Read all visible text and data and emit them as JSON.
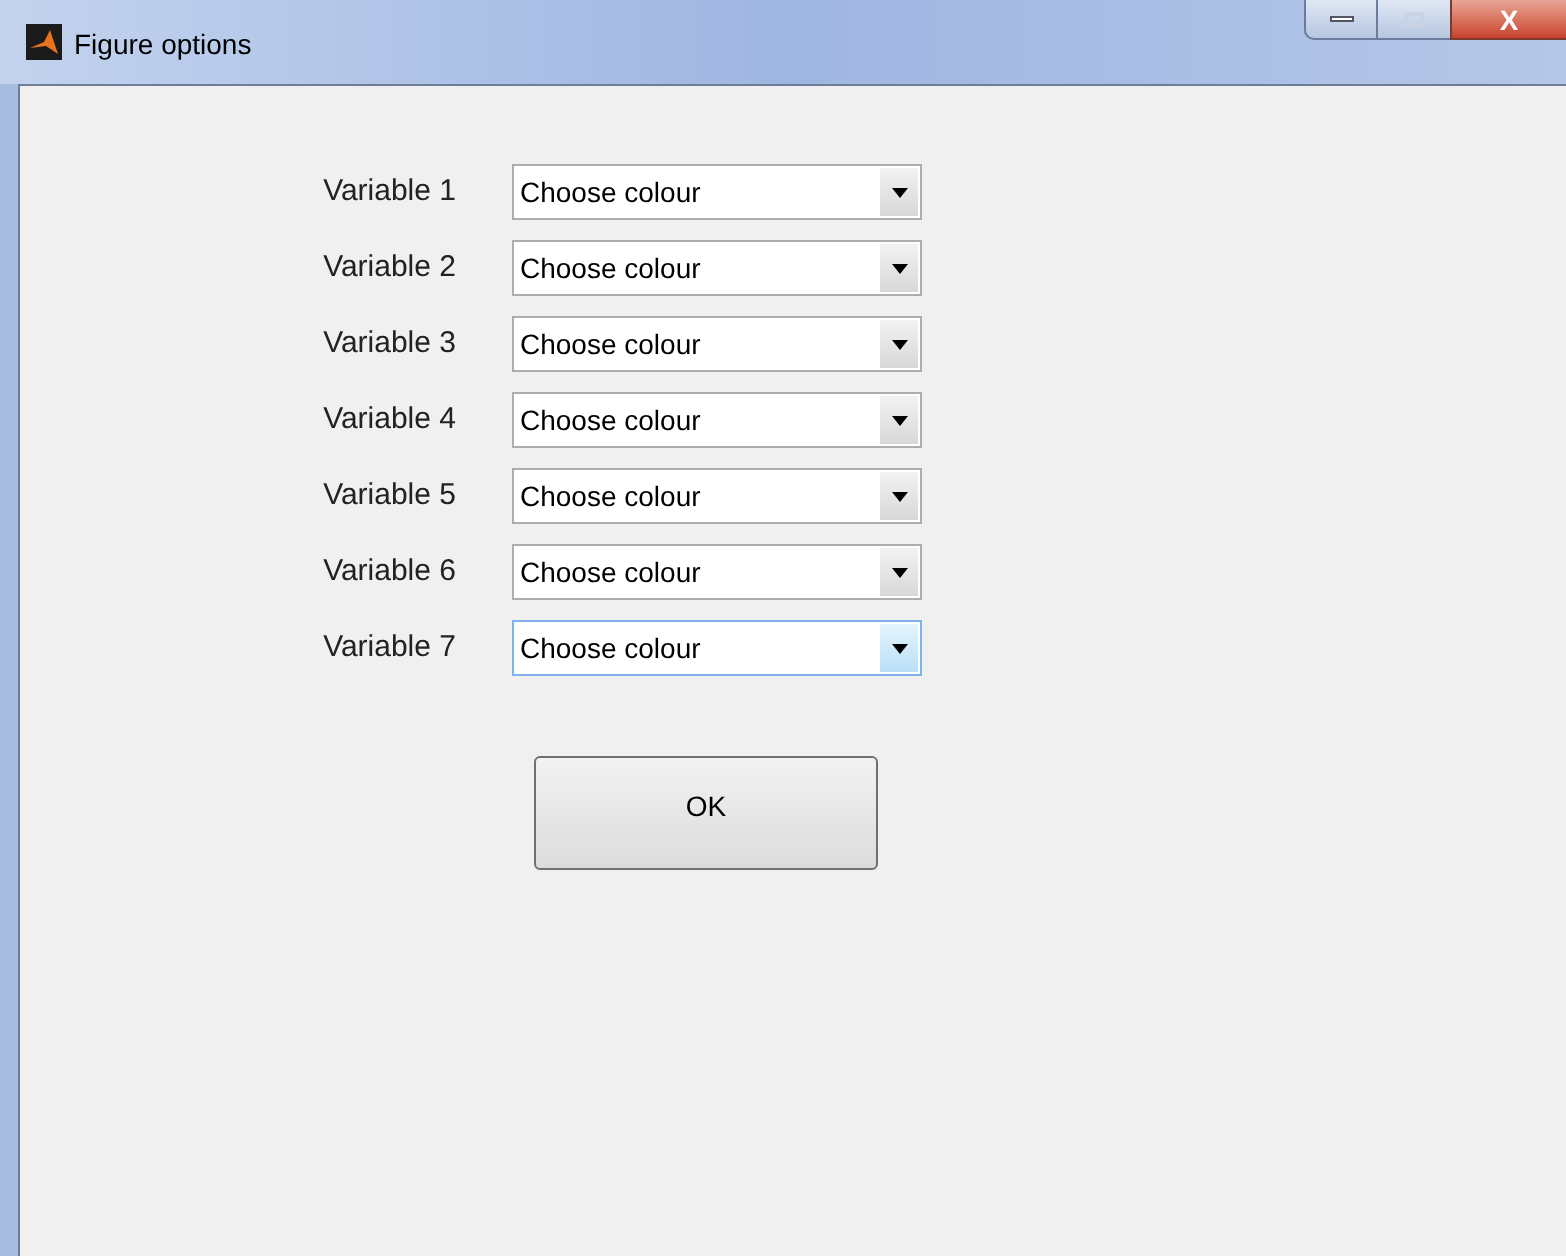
{
  "window": {
    "title": "Figure options",
    "close_label": "X"
  },
  "rows": [
    {
      "label": "Variable 1",
      "value": "Choose colour",
      "hovered": false
    },
    {
      "label": "Variable 2",
      "value": "Choose colour",
      "hovered": false
    },
    {
      "label": "Variable 3",
      "value": "Choose colour",
      "hovered": false
    },
    {
      "label": "Variable 4",
      "value": "Choose colour",
      "hovered": false
    },
    {
      "label": "Variable 5",
      "value": "Choose colour",
      "hovered": false
    },
    {
      "label": "Variable 6",
      "value": "Choose colour",
      "hovered": false
    },
    {
      "label": "Variable 7",
      "value": "Choose colour",
      "hovered": true
    }
  ],
  "ok_button": "OK"
}
